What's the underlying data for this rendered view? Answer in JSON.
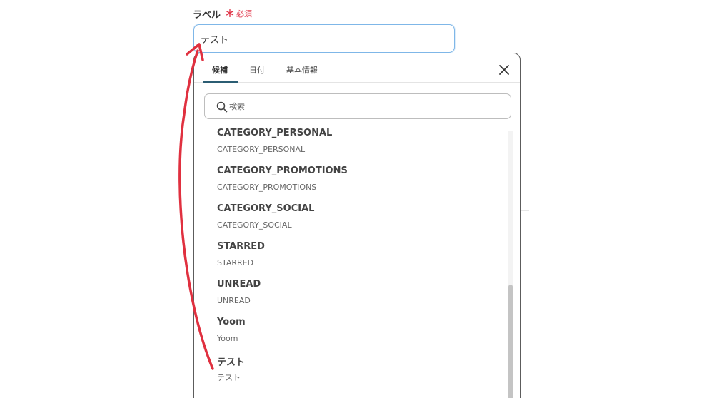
{
  "field": {
    "label": "ラベル",
    "required_mark": "＊",
    "required_text": "必須",
    "value": "テスト"
  },
  "popup": {
    "tabs": [
      {
        "label": "候補"
      },
      {
        "label": "日付"
      },
      {
        "label": "基本情報"
      }
    ],
    "search_placeholder": "検索",
    "items": [
      {
        "title": "CATEGORY_PERSONAL",
        "sub": "CATEGORY_PERSONAL"
      },
      {
        "title": "CATEGORY_PROMOTIONS",
        "sub": "CATEGORY_PROMOTIONS"
      },
      {
        "title": "CATEGORY_SOCIAL",
        "sub": "CATEGORY_SOCIAL"
      },
      {
        "title": "STARRED",
        "sub": "STARRED"
      },
      {
        "title": "UNREAD",
        "sub": "UNREAD"
      },
      {
        "title": "Yoom",
        "sub": "Yoom"
      },
      {
        "title": "テスト",
        "sub": "テスト"
      }
    ]
  },
  "colors": {
    "required": "#e0384b",
    "tab_active_underline": "#2b5d73",
    "input_focus_border": "#7fb7e8",
    "annotation_arrow": "#e0303f"
  },
  "icons": {
    "close": "close-icon",
    "search": "search-icon"
  }
}
